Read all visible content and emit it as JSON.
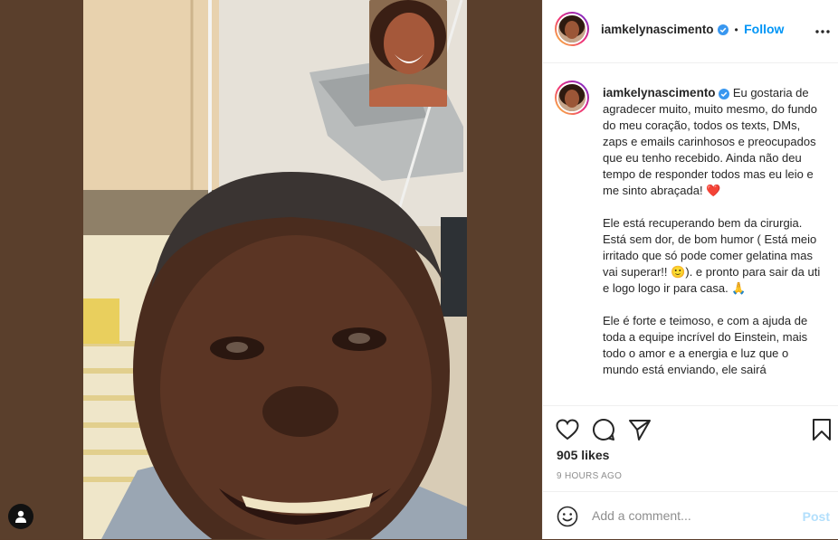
{
  "post": {
    "username": "iamkelynascimento",
    "follow_label": "Follow",
    "separator": "•",
    "caption": {
      "p1": "Eu gostaria de agradecer muito, muito mesmo, do fundo do meu coração, todos os texts, DMs, zaps e emails carinhosos e preocupados que eu tenho recebido. Ainda não deu tempo de responder todos mas eu leio e me sinto abraçada!",
      "p2a": "Ele está recuperando bem da cirurgia. Está sem dor, de bom humor ( Está meio irritado que só pode comer gelatina mas vai superar!!",
      "p2b": "). e pronto para sair da uti e logo logo ir para casa.",
      "p3": "Ele é forte e teimoso, e com a ajuda de toda a equipe incrível do Einstein, mais todo o amor e a energia e luz que o mundo está enviando, ele sairá"
    },
    "emoji": {
      "heart": "❤️",
      "smile": "🙂",
      "pray": "🙏"
    },
    "likes": "905 likes",
    "timestamp": "9 HOURS AGO",
    "comment_placeholder": "Add a comment...",
    "post_label": "Post"
  },
  "icons": {
    "more": "more-options-icon",
    "like": "heart-icon",
    "comment": "comment-icon",
    "share": "paper-plane-icon",
    "save": "bookmark-icon",
    "emoji": "smiley-icon",
    "verified": "verified-badge-icon",
    "account": "account-icon"
  },
  "colors": {
    "link": "#0095f6",
    "post_disabled": "#b2dffc",
    "verified": "#3897f0",
    "text": "#262626",
    "muted": "#8e8e8e"
  }
}
